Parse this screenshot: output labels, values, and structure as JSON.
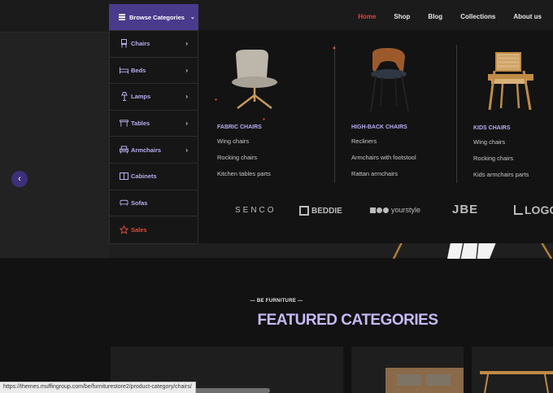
{
  "nav": {
    "items": [
      {
        "label": "Home",
        "active": true
      },
      {
        "label": "Shop"
      },
      {
        "label": "Blog"
      },
      {
        "label": "Collections"
      },
      {
        "label": "About us"
      }
    ]
  },
  "browse": {
    "label": "Browse Categories",
    "icon": "hamburger-icon",
    "items": [
      {
        "label": "Chairs",
        "icon": "chair-icon",
        "has_submenu": true
      },
      {
        "label": "Beds",
        "icon": "bed-icon",
        "has_submenu": true
      },
      {
        "label": "Lamps",
        "icon": "lamp-icon",
        "has_submenu": true
      },
      {
        "label": "Tables",
        "icon": "table-icon",
        "has_submenu": true
      },
      {
        "label": "Armchairs",
        "icon": "armchair-icon",
        "has_submenu": true
      },
      {
        "label": "Cabinets",
        "icon": "cabinet-icon",
        "has_submenu": false
      },
      {
        "label": "Sofas",
        "icon": "sofa-icon",
        "has_submenu": false
      },
      {
        "label": "Sales",
        "icon": "star-icon",
        "has_submenu": false
      }
    ]
  },
  "mega": {
    "columns": [
      {
        "title": "FABRIC CHAIRS",
        "links": [
          "Wing chairs",
          "Rocking chairs",
          "Kitchen tables parts"
        ]
      },
      {
        "title": "HIGH-BACK CHAIRS",
        "links": [
          "Recliners",
          "Armchairs with footstool",
          "Rattan armchairs"
        ]
      },
      {
        "title": "KIDS CHAIRS",
        "links": [
          "Wing chairs",
          "Rocking chairs",
          "Kids armchairs parts"
        ]
      }
    ],
    "brands": [
      "SENCO",
      "BEDDIE",
      "yourstyle",
      "JBE",
      "LOGO"
    ]
  },
  "featured": {
    "eyebrow": "— BE FURNITURE —",
    "title": "FEATURED CATEGORIES"
  },
  "status_url": "https://themes.muffingroup.com/be/furniturestore2/product-category/chairs/",
  "colors": {
    "accent": "#4a3a8c",
    "link": "#b9aef0",
    "active": "#e0443a",
    "featured": "#c7b9f5"
  }
}
